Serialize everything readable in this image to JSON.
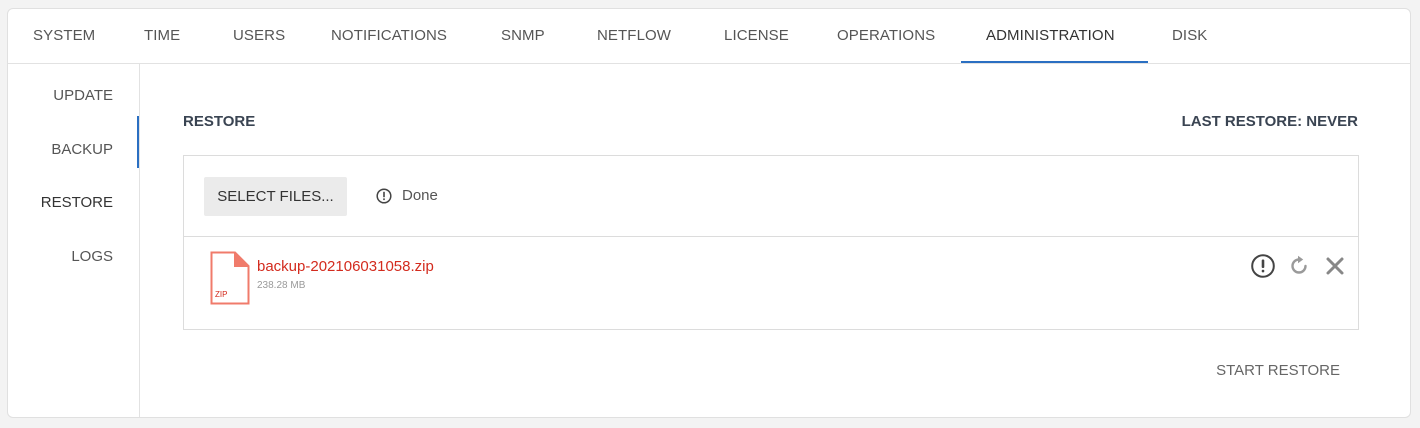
{
  "tabs": [
    {
      "label": "SYSTEM"
    },
    {
      "label": "TIME"
    },
    {
      "label": "USERS"
    },
    {
      "label": "NOTIFICATIONS"
    },
    {
      "label": "SNMP"
    },
    {
      "label": "NETFLOW"
    },
    {
      "label": "LICENSE"
    },
    {
      "label": "OPERATIONS"
    },
    {
      "label": "ADMINISTRATION",
      "active": true
    },
    {
      "label": "DISK"
    }
  ],
  "sidebar": {
    "items": [
      {
        "label": "UPDATE"
      },
      {
        "label": "BACKUP"
      },
      {
        "label": "RESTORE",
        "active": true
      },
      {
        "label": "LOGS"
      }
    ]
  },
  "main": {
    "title": "RESTORE",
    "last_restore": "LAST RESTORE: NEVER",
    "upload": {
      "select_label": "SELECT FILES...",
      "status_icon": "info-circle-icon",
      "status_text": "Done",
      "file": {
        "icon": "zip-file-icon",
        "icon_text": "ZIP",
        "name": "backup-202106031058.zip",
        "size": "238.28 MB",
        "actions": [
          "warning-icon",
          "retry-icon",
          "remove-icon"
        ]
      }
    },
    "start_label": "START RESTORE"
  },
  "colors": {
    "accent": "#2a6fc2",
    "error": "#d32b1e",
    "file_icon": "#f07b6b"
  }
}
